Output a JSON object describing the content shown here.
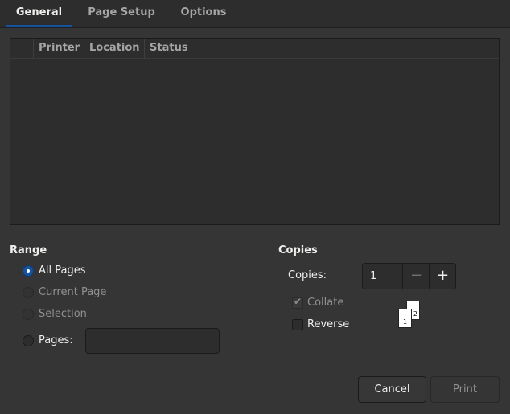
{
  "tabs": [
    {
      "label": "General",
      "active": true
    },
    {
      "label": "Page Setup",
      "active": false
    },
    {
      "label": "Options",
      "active": false
    }
  ],
  "printer_list": {
    "columns": [
      "Printer",
      "Location",
      "Status"
    ],
    "rows": []
  },
  "range": {
    "title": "Range",
    "options": [
      {
        "label": "All Pages",
        "checked": true,
        "enabled": true
      },
      {
        "label": "Current Page",
        "checked": false,
        "enabled": false
      },
      {
        "label": "Selection",
        "checked": false,
        "enabled": false
      },
      {
        "label": "Pages:",
        "checked": false,
        "enabled": true
      }
    ],
    "pages_value": ""
  },
  "copies": {
    "title": "Copies",
    "label": "Copies:",
    "value": "1",
    "minus_icon": "−",
    "plus_icon": "+",
    "collate": {
      "label": "Collate",
      "checked": true,
      "enabled": false
    },
    "reverse": {
      "label": "Reverse",
      "checked": false,
      "enabled": true
    },
    "collate_page_numbers": [
      "2",
      "1"
    ]
  },
  "buttons": {
    "cancel": "Cancel",
    "print": "Print"
  },
  "colors": {
    "background": "#353535",
    "accent": "#15539e"
  }
}
